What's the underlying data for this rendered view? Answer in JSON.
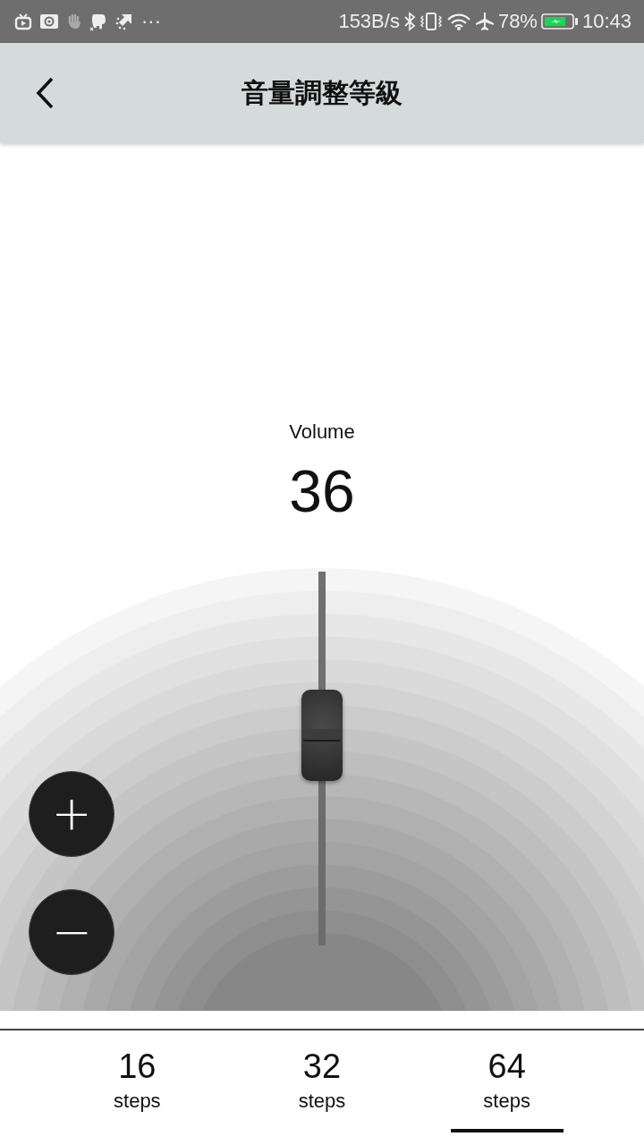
{
  "status_bar": {
    "more": "···",
    "net_speed": "153B/s",
    "battery": "78%",
    "time": "10:43"
  },
  "header": {
    "title": "音量調整等級"
  },
  "volume": {
    "label": "Volume",
    "value": "36"
  },
  "slider": {
    "level": 0.5625
  },
  "buttons": {
    "plus": "+",
    "minus": "−"
  },
  "tabs": [
    {
      "value": "16",
      "unit": "steps",
      "selected": false
    },
    {
      "value": "32",
      "unit": "steps",
      "selected": false
    },
    {
      "value": "64",
      "unit": "steps",
      "selected": true
    }
  ]
}
